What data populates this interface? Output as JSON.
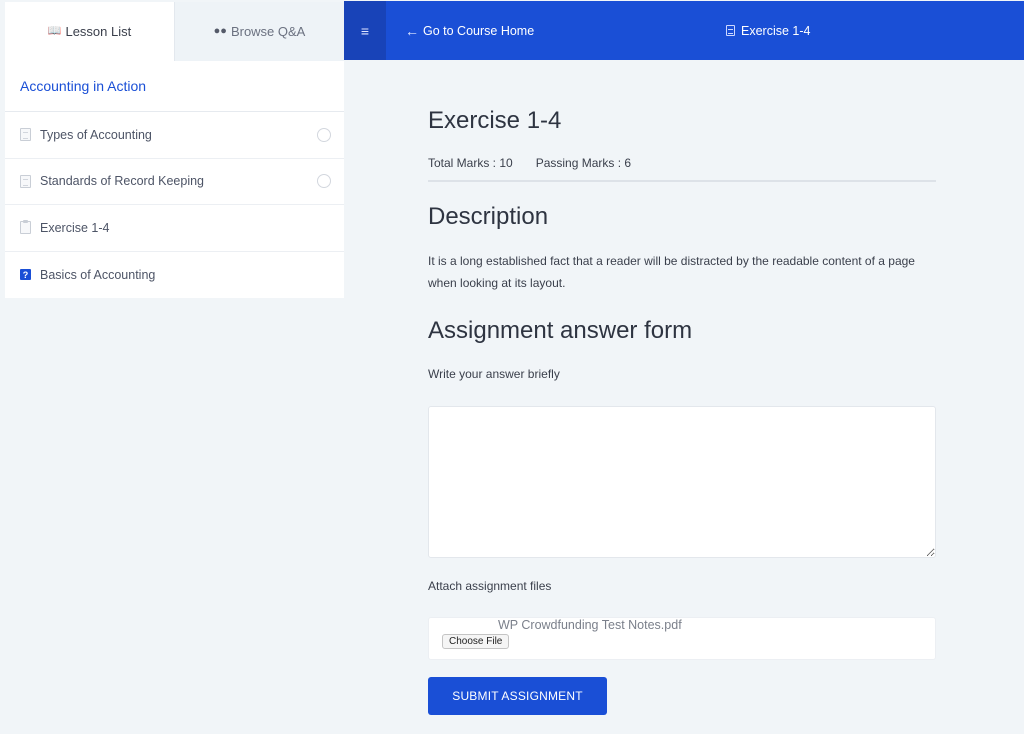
{
  "sidebar": {
    "tabs": [
      {
        "label": "Lesson List",
        "icon": "book-icon",
        "active": true
      },
      {
        "label": "Browse Q&A",
        "icon": "chat-icon",
        "active": false
      }
    ],
    "topic_title": "Accounting in Action",
    "items": [
      {
        "label": "Types of Accounting",
        "type": "lesson",
        "icon": "document-icon"
      },
      {
        "label": "Standards of Record Keeping",
        "type": "lesson",
        "icon": "document-icon"
      },
      {
        "label": "Exercise 1-4",
        "type": "assignment",
        "icon": "clipboard-icon"
      },
      {
        "label": "Basics of Accounting",
        "type": "quiz",
        "icon": "quiz-icon"
      }
    ]
  },
  "topbar": {
    "back_label": "Go to Course Home",
    "current_title": "Exercise 1-4"
  },
  "main": {
    "title": "Exercise 1-4",
    "total_marks": "Total Marks : 10",
    "passing_marks": "Passing Marks : 6",
    "description_heading": "Description",
    "description_text": "It is a long established fact that a reader will be distracted by the readable content of a page when looking at its layout.",
    "form_heading": "Assignment answer form",
    "answer_label": "Write your answer briefly",
    "answer_value": "",
    "attach_label": "Attach assignment files",
    "file_name": "WP Crowdfunding Test Notes.pdf",
    "choose_file_label": "Choose File",
    "submit_label": "SUBMIT ASSIGNMENT"
  },
  "colors": {
    "accent": "#1a4fd6",
    "accent_dark": "#1843b8",
    "page_bg": "#f1f5f8"
  }
}
